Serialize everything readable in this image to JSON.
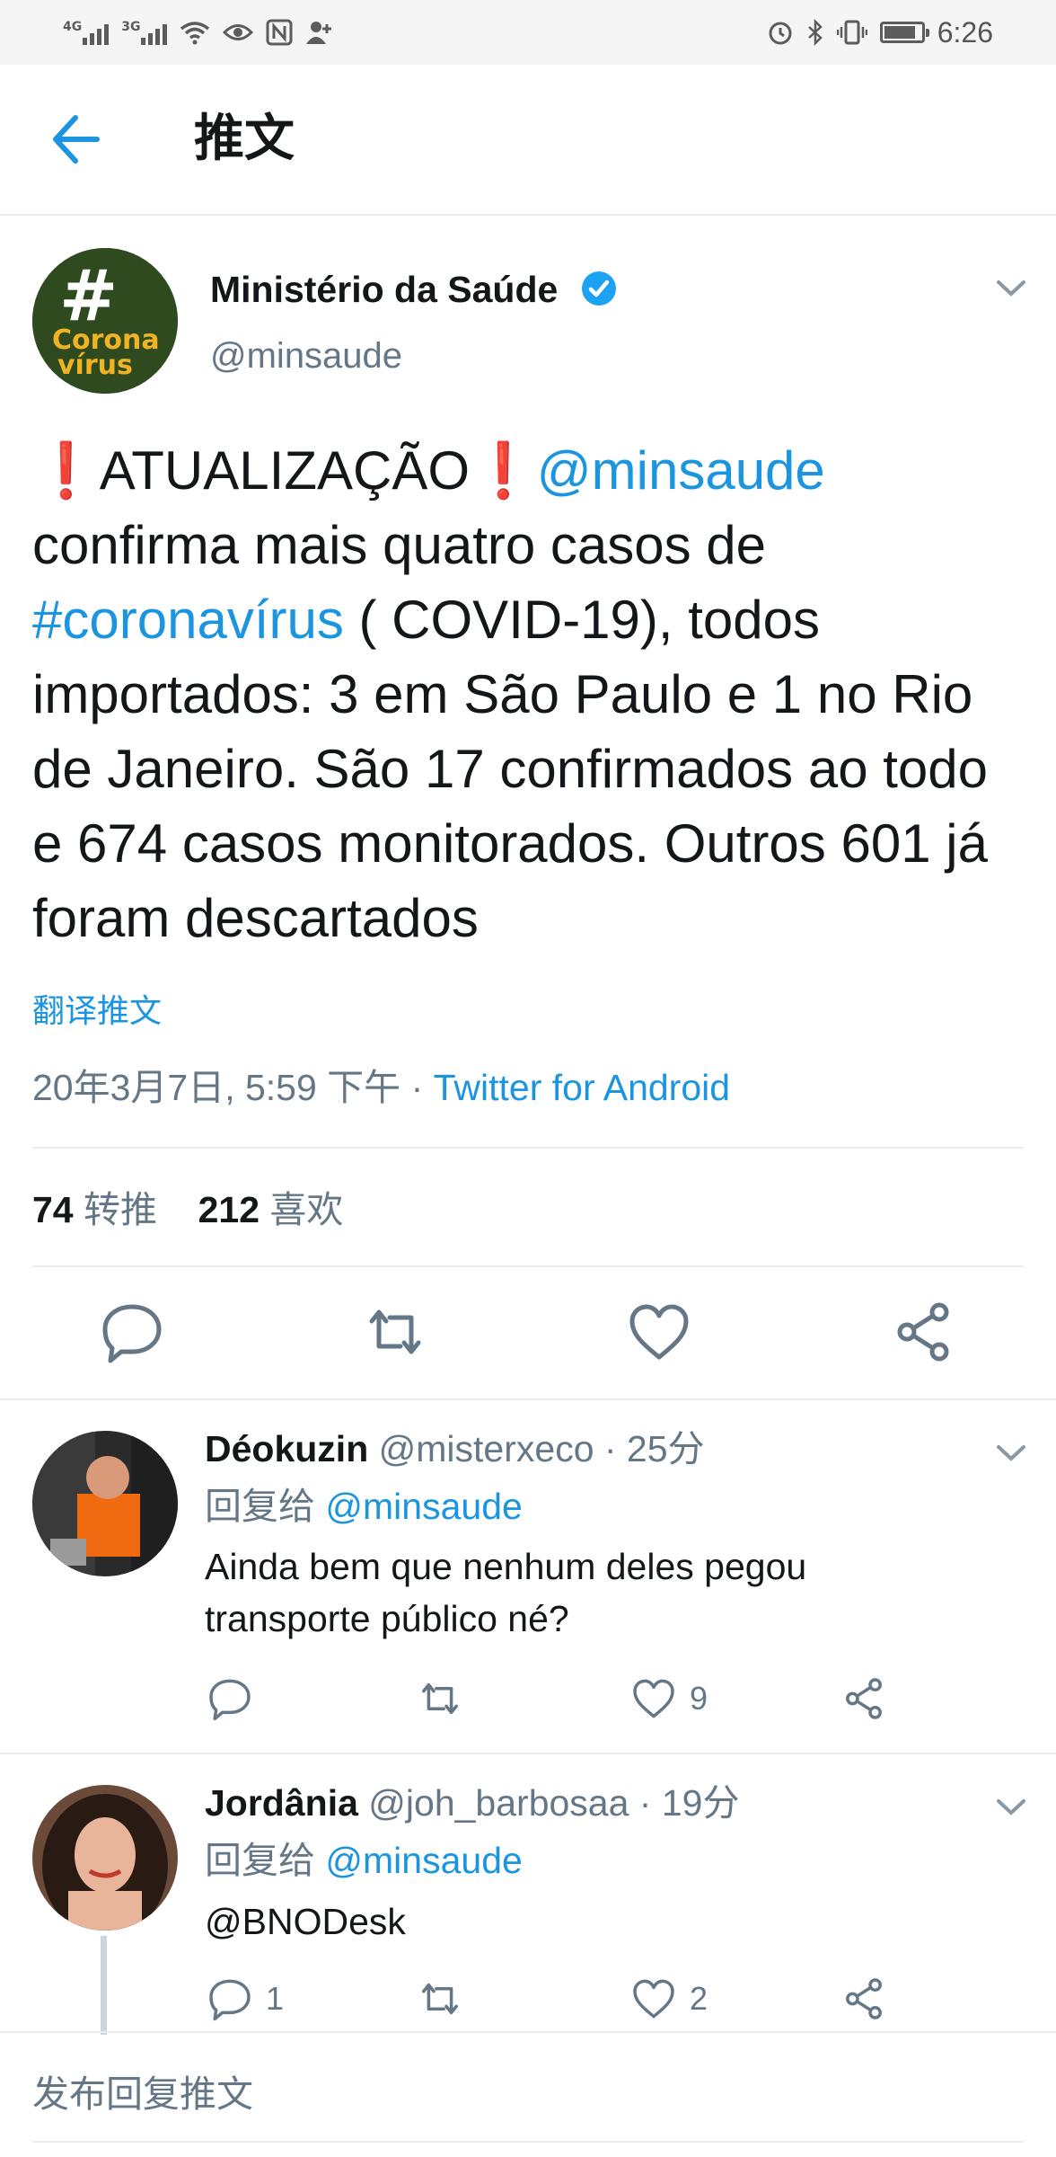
{
  "status_bar": {
    "signal1_label": "4G",
    "signal2_label": "3G",
    "time": "6:26",
    "battery_level": 0.85
  },
  "header": {
    "title": "推文"
  },
  "tweet": {
    "author_name": "Ministério da Saúde",
    "author_handle": "@minsaude",
    "avatar_text_top": "#",
    "avatar_text_1": "Corona",
    "avatar_text_2": "vírus",
    "text": {
      "t1": "ATUALIZAÇÃO",
      "t2": "@minsaude",
      "t3": "confirma mais quatro casos de",
      "t4": "#coronavírus",
      "t5": " ( COVID-19), todos importados: 3 em São Paulo e 1 no Rio de Janeiro. São 17 confirmados ao todo e 674 casos monitorados. Outros 601 já foram descartados"
    },
    "translate_label": "翻译推文",
    "timestamp": "20年3月7日, 5:59 下午 · ",
    "source": "Twitter for Android",
    "retweet_count": "74",
    "retweet_label": "转推",
    "like_count": "212",
    "like_label": "喜欢"
  },
  "replies": [
    {
      "name": "Déokuzin",
      "handle": "@misterxeco",
      "time": " · 25分",
      "reply_to_label": "回复给 ",
      "reply_to_handle": "@minsaude",
      "text": "Ainda bem que nenhum deles pegou transporte público né?",
      "reply_count": "",
      "retweet_count": "",
      "like_count": "9"
    },
    {
      "name": "Jordânia",
      "handle": "@joh_barbosaa",
      "time": " · 19分",
      "reply_to_label": "回复给 ",
      "reply_to_handle": "@minsaude",
      "text": "@BNODesk",
      "reply_count": "1",
      "retweet_count": "",
      "like_count": "2"
    }
  ],
  "compose": {
    "placeholder": "发布回复推文"
  },
  "colors": {
    "accent": "#1b95e0",
    "muted": "#657786",
    "alert": "#d4202f",
    "divider": "#e6ecf0"
  }
}
